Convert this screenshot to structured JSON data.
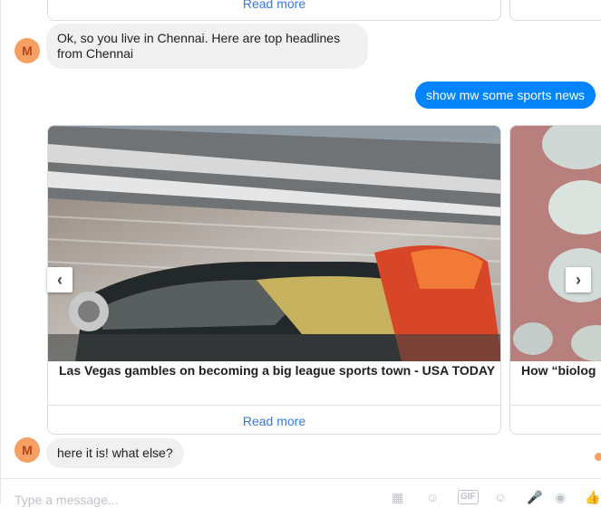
{
  "messages": {
    "top_card_1_readmore": "Read more",
    "bot_1": "Ok, so you live in Chennai. Here are top headlines from Chennai",
    "avatar_letter": "M",
    "user_1": "show mw some sports news",
    "bot_2": "here it is! what else?"
  },
  "carousel": {
    "cards": [
      {
        "title": "Las Vegas gambles on becoming a big league sports town - USA TODAY",
        "read_more": "Read more"
      },
      {
        "title": "How “biolog",
        "read_more": ""
      }
    ],
    "prev_icon": "chevron-left-icon",
    "next_icon": "chevron-right-icon"
  },
  "composer": {
    "placeholder": "Type a message...",
    "icons": [
      "image-icon",
      "sticker-icon",
      "gif-icon",
      "emoji-icon",
      "microphone-icon",
      "camera-icon",
      "thumbs-up-icon"
    ],
    "gif_label": "GIF"
  },
  "colors": {
    "accent": "#0084ff",
    "link": "#3578e5",
    "bubble_gray": "#f1f0f0",
    "avatar": "#f6a064"
  }
}
